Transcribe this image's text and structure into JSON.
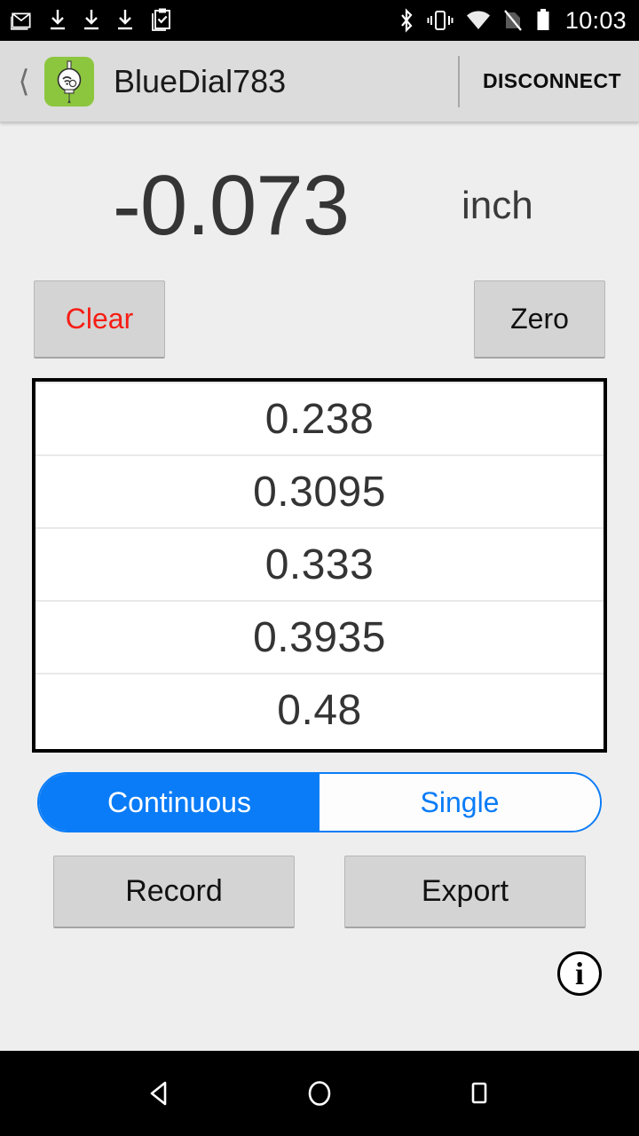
{
  "status_bar": {
    "time": "10:03",
    "left_icons": [
      "gmail-icon",
      "download-icon",
      "download-icon",
      "download-icon",
      "clipboard-check-icon"
    ],
    "right_icons": [
      "bluetooth-icon",
      "vibrate-icon",
      "wifi-icon",
      "no-sim-icon",
      "battery-icon"
    ]
  },
  "app_bar": {
    "back_icon": "back-chevron-icon",
    "app_icon": "dial-indicator-icon",
    "title": "BlueDial783",
    "disconnect_label": "DISCONNECT"
  },
  "measurement": {
    "value": "-0.073",
    "unit": "inch"
  },
  "actions": {
    "clear_label": "Clear",
    "zero_label": "Zero",
    "record_label": "Record",
    "export_label": "Export",
    "info_label": "i"
  },
  "readings": [
    {
      "value": "0.238"
    },
    {
      "value": "0.3095"
    },
    {
      "value": "0.333"
    },
    {
      "value": "0.3935"
    },
    {
      "value": "0.48"
    }
  ],
  "mode_toggle": {
    "continuous_label": "Continuous",
    "single_label": "Single",
    "selected": "Continuous"
  },
  "nav_bar": {
    "back_icon": "nav-back-triangle-icon",
    "home_icon": "nav-home-circle-icon",
    "recents_icon": "nav-recents-square-icon"
  },
  "colors": {
    "accent_blue": "#0a7cf7",
    "clear_red": "#f61d14",
    "app_icon_green": "#8cc63e",
    "background": "#eeeeee",
    "appbar": "#dcdcdc"
  }
}
